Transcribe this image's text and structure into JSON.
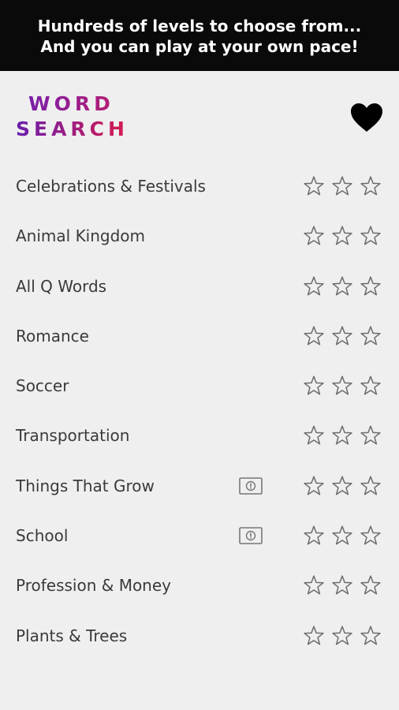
{
  "banner": {
    "line1": "Hundreds of levels to choose from...",
    "line2": "And you can play at your own pace!"
  },
  "logo": {
    "line1": "WORD",
    "line2": "SEARCH"
  },
  "header": {
    "favorite_icon": "heart-icon"
  },
  "colors": {
    "logo_gradient_start": "#6a1fae",
    "logo_gradient_end": "#d81b4f",
    "text": "#3a3a3a",
    "star_outline": "#6b6b6b",
    "background": "#efefef",
    "banner": "#0a0a0a"
  },
  "categories": [
    {
      "label": "Celebrations & Festivals",
      "ad": false,
      "stars_earned": 0,
      "stars_total": 3
    },
    {
      "label": "Animal Kingdom",
      "ad": false,
      "stars_earned": 0,
      "stars_total": 3
    },
    {
      "label": "All Q Words",
      "ad": false,
      "stars_earned": 0,
      "stars_total": 3
    },
    {
      "label": "Romance",
      "ad": false,
      "stars_earned": 0,
      "stars_total": 3
    },
    {
      "label": "Soccer",
      "ad": false,
      "stars_earned": 0,
      "stars_total": 3
    },
    {
      "label": "Transportation",
      "ad": false,
      "stars_earned": 0,
      "stars_total": 3
    },
    {
      "label": "Things That Grow",
      "ad": true,
      "stars_earned": 0,
      "stars_total": 3
    },
    {
      "label": "School",
      "ad": true,
      "stars_earned": 0,
      "stars_total": 3
    },
    {
      "label": "Profession & Money",
      "ad": false,
      "stars_earned": 0,
      "stars_total": 3
    },
    {
      "label": "Plants & Trees",
      "ad": false,
      "stars_earned": 0,
      "stars_total": 3
    }
  ]
}
